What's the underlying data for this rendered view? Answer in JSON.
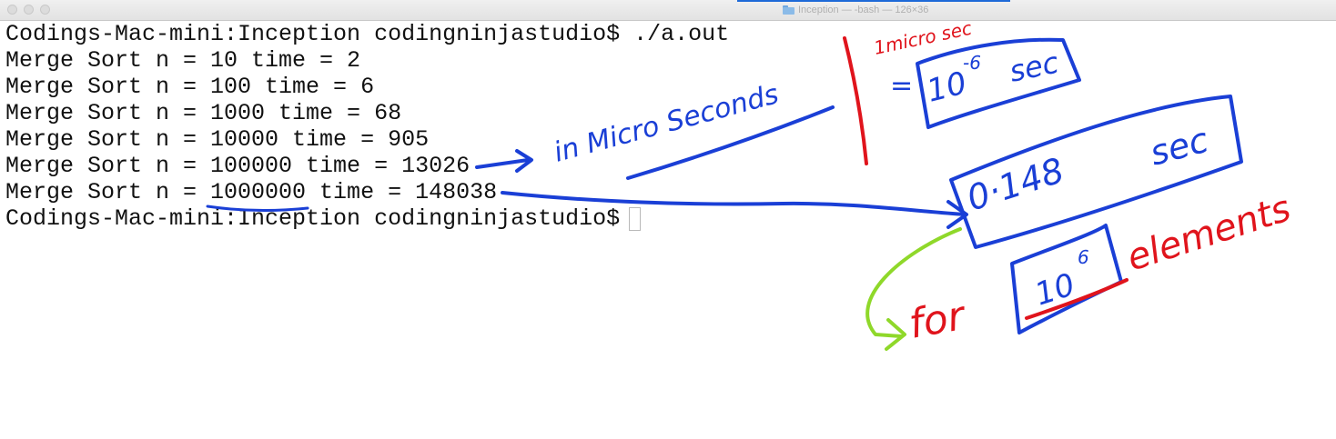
{
  "window": {
    "title": "Inception — -bash — 126×36",
    "title_icon": "folder-icon",
    "traffic_lights": [
      "close-button",
      "minimize-button",
      "maximize-button"
    ]
  },
  "terminal": {
    "lines": [
      "Codings-Mac-mini:Inception codingninjastudio$ ./a.out",
      "Merge Sort n = 10 time = 2",
      "Merge Sort n = 100 time = 6",
      "Merge Sort n = 1000 time = 68",
      "Merge Sort n = 10000 time = 905",
      "Merge Sort n = 100000 time = 13026",
      "Merge Sort n = 1000000 time = 148038"
    ],
    "prompt": "Codings-Mac-mini:Inception codingninjastudio$"
  },
  "annotations": {
    "in_micro_seconds": "in Micro Seconds",
    "one_micro_sec": "1micro sec",
    "equals": "=",
    "ten_base": "10",
    "neg_six_exp": "-6",
    "sec_1": "sec",
    "value_0148": "0·148",
    "sec_2": "sec",
    "for": "for",
    "ten_base_2": "10",
    "six_exp": "6",
    "elements": "elements",
    "colors": {
      "blue": "#1a3fd6",
      "red": "#e0141c",
      "green": "#8fd82a"
    }
  }
}
